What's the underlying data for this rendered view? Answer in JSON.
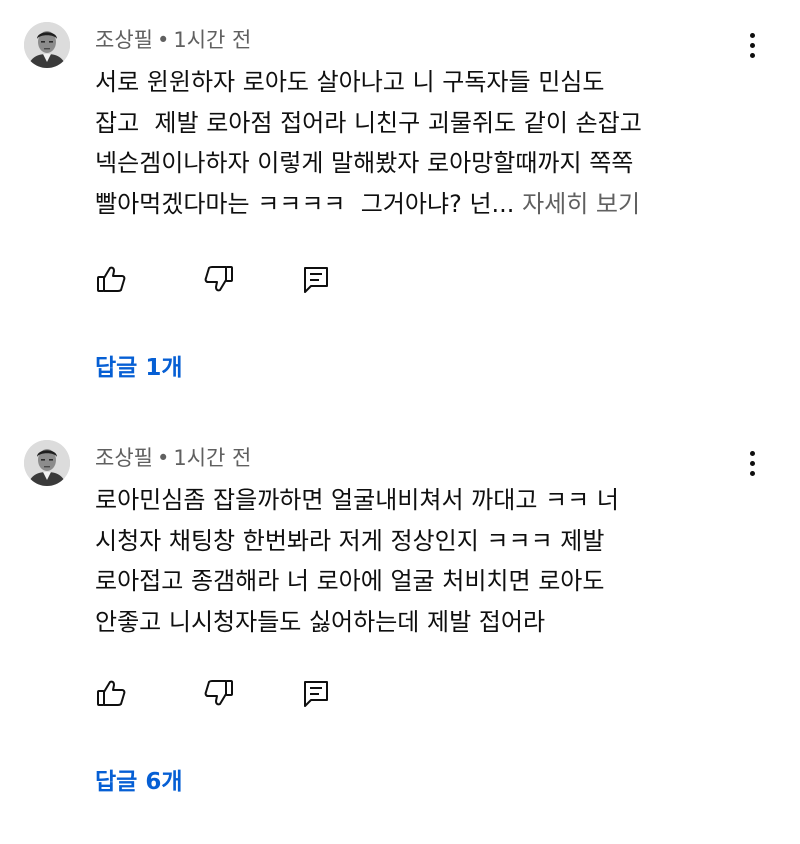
{
  "comments": [
    {
      "author": "조상필",
      "separator": "•",
      "time": "1시간 전",
      "text": "서로 윈윈하자 로아도 살아나고 니 구독자들 민심도\n잡고  제발 로아점 접어라 니친구 괴물쥐도 같이 손잡고\n넥슨겜이나하자 이렇게 말해봤자 로아망할때까지 쪽쪽\n빨아먹겠다마는 ㅋㅋㅋㅋ  그거아냐? 넌...",
      "read_more": "자세히 보기",
      "replies": "답글 1개",
      "icons": [
        "more-vert-icon",
        "thumbs-up-icon",
        "thumbs-down-icon",
        "comment-reply-icon"
      ]
    },
    {
      "author": "조상필",
      "separator": "•",
      "time": "1시간 전",
      "text": "로아민심좀 잡을까하면 얼굴내비쳐서 까대고 ㅋㅋ 너\n시청자 채팅창 한번봐라 저게 정상인지 ㅋㅋㅋ 제발\n로아접고 종갬해라 너 로아에 얼굴 처비치면 로아도\n안좋고 니시청자들도 싫어하는데 제발 접어라",
      "replies": "답글 6개",
      "icons": [
        "more-vert-icon",
        "thumbs-up-icon",
        "thumbs-down-icon",
        "comment-reply-icon"
      ]
    }
  ],
  "colors": {
    "text": "#0f0f0f",
    "meta": "#606060",
    "link": "#065fd4",
    "background": "#ffffff"
  }
}
